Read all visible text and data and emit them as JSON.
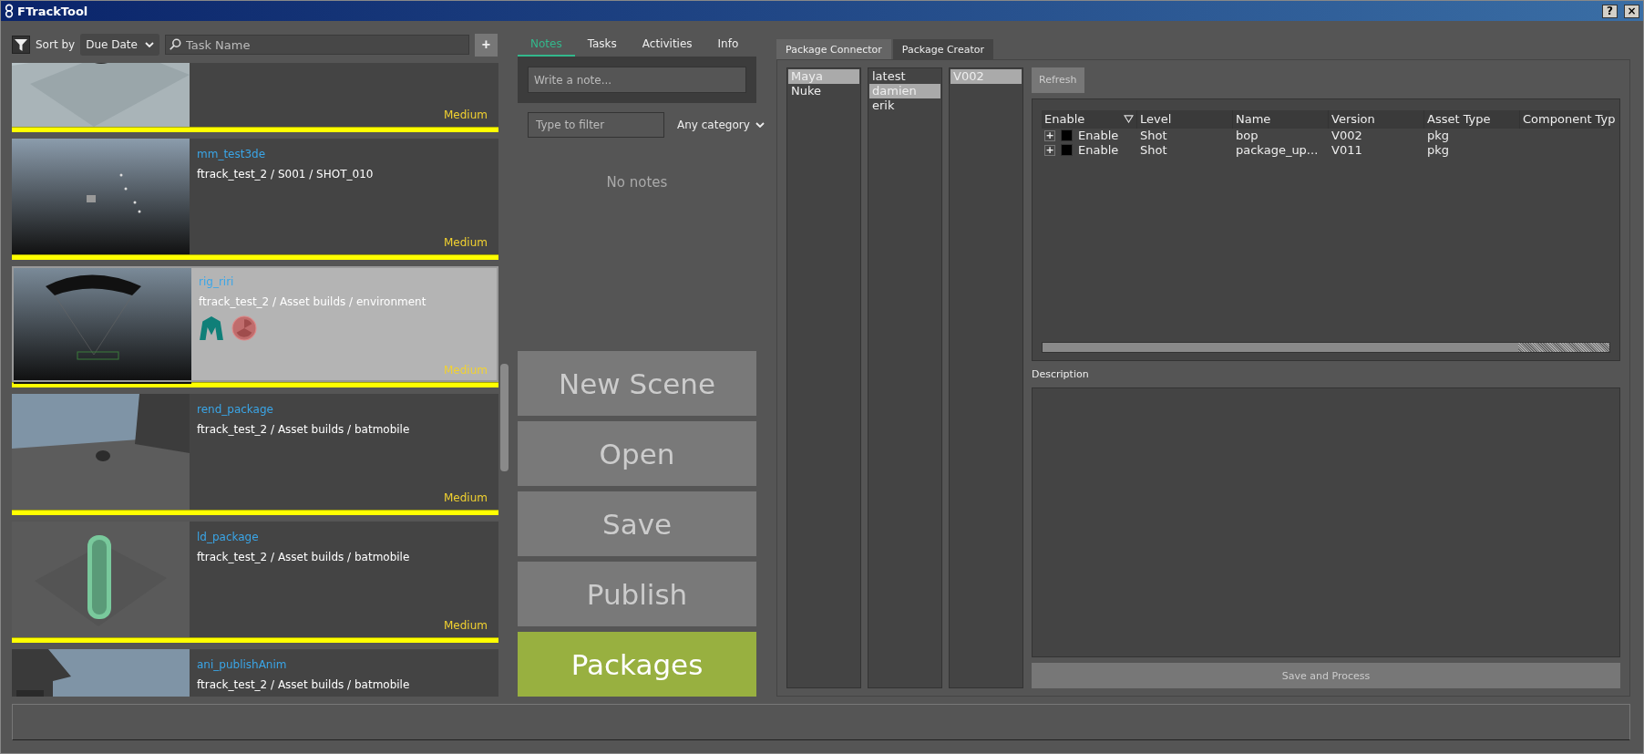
{
  "window": {
    "title": "FTrackTool",
    "buttons": [
      {
        "kind": "help",
        "label": "?"
      },
      {
        "kind": "close",
        "label": "×"
      }
    ]
  },
  "toolbar": {
    "sort_label": "Sort by",
    "sort_value": "Due Date",
    "search_placeholder": "Task Name",
    "add_label": "+"
  },
  "tasks": [
    {
      "priority": "Medium",
      "selected": false
    },
    {
      "name": "mm_test3de",
      "path": "ftrack_test_2 / S001 / SHOT_010",
      "priority": "Medium",
      "selected": false
    },
    {
      "name": "rig_riri",
      "path": "ftrack_test_2 / Asset builds / environment",
      "priority": "Medium",
      "selected": true,
      "apps": [
        {
          "kind": "maya"
        },
        {
          "kind": "nuke"
        }
      ]
    },
    {
      "name": "rend_package",
      "path": "ftrack_test_2 / Asset builds / batmobile",
      "priority": "Medium",
      "selected": false
    },
    {
      "name": "ld_package",
      "path": "ftrack_test_2 / Asset builds / batmobile",
      "priority": "Medium",
      "selected": false
    },
    {
      "name": "ani_publishAnim",
      "path": "ftrack_test_2 / Asset builds / batmobile",
      "selected": false
    }
  ],
  "notes_tabs": [
    {
      "label": "Notes",
      "selected": true
    },
    {
      "label": "Tasks",
      "selected": false
    },
    {
      "label": "Activities",
      "selected": false
    },
    {
      "label": "Info",
      "selected": false
    }
  ],
  "notes": {
    "write_placeholder": "Write a note...",
    "filter_placeholder": "Type to filter",
    "category": "Any category",
    "empty": "No notes"
  },
  "actions": [
    {
      "label": "New Scene",
      "selected": false
    },
    {
      "label": "Open",
      "selected": false
    },
    {
      "label": "Save",
      "selected": false
    },
    {
      "label": "Publish",
      "selected": false
    },
    {
      "label": "Packages",
      "selected": true
    }
  ],
  "package_tabs": [
    {
      "label": "Package Connector",
      "selected": false
    },
    {
      "label": "Package Creator",
      "selected": true
    }
  ],
  "lists": [
    [
      {
        "label": "Maya",
        "selected": true
      },
      {
        "label": "Nuke",
        "selected": false
      }
    ],
    [
      {
        "label": "latest",
        "selected": false
      },
      {
        "label": "damien",
        "selected": true
      },
      {
        "label": "erik",
        "selected": false
      }
    ],
    [
      {
        "label": "V002",
        "selected": true
      }
    ]
  ],
  "refresh": "Refresh",
  "table": {
    "columns": [
      "Enable",
      "Level",
      "Name",
      "Version",
      "Asset Type",
      "Component Typ"
    ],
    "rows": [
      {
        "expander": "+",
        "checked": false,
        "enable": "Enable",
        "level": "Shot",
        "name": "bop",
        "version": "V002",
        "asset_type": "pkg"
      },
      {
        "expander": "+",
        "checked": false,
        "enable": "Enable",
        "level": "Shot",
        "name": "package_up...",
        "version": "V011",
        "asset_type": "pkg"
      }
    ]
  },
  "description_label": "Description",
  "save_process": "Save and Process"
}
